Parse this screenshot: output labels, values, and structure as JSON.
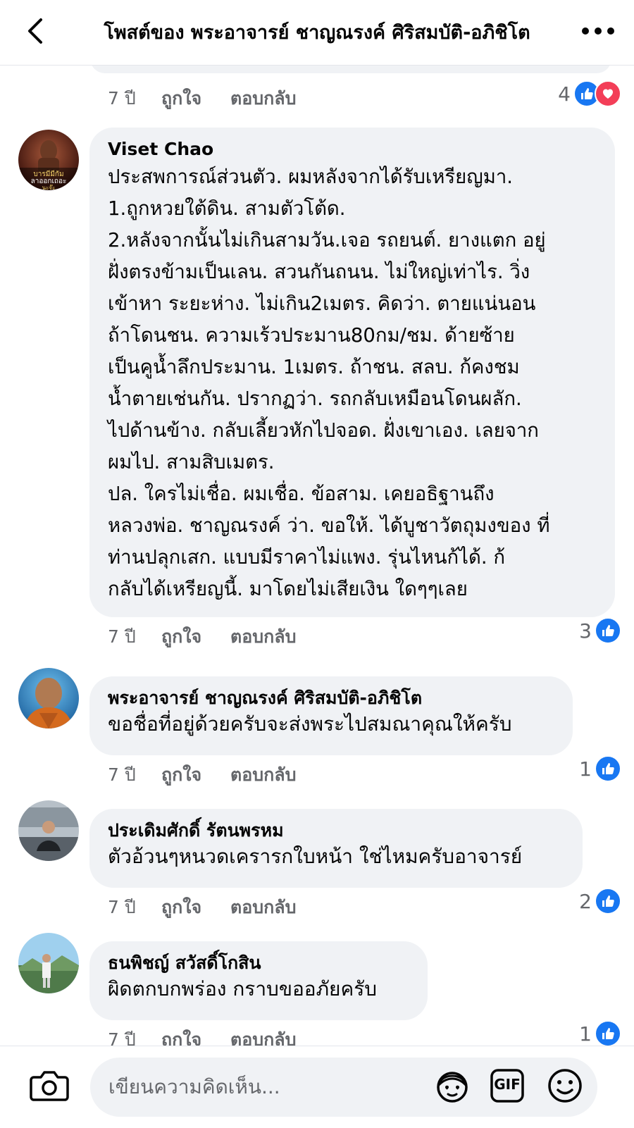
{
  "header": {
    "title": "โพสต์ของ พระอาจารย์ ชาญณรงค์ ศิริสมบัติ-อภิชิโต",
    "back_icon": "chevron-left-icon",
    "more_icon": "more-dots-icon"
  },
  "actions": {
    "like_label": "ถูกใจ",
    "reply_label": "ตอบกลับ"
  },
  "colors": {
    "accent": "#1877f2",
    "love": "#f33e58",
    "bubble": "#f0f2f5",
    "meta": "#65676b"
  },
  "comments": [
    {
      "author": "",
      "text": "",
      "time": "7 ปี",
      "reaction_count": "4",
      "reactions": [
        "like-icon",
        "love-icon"
      ]
    },
    {
      "author": "Viset Chao",
      "avatar_text": "บารมีมีกัมมีโส ลาออกเถอะ นะจ๊ะ",
      "text": "ประสพการณ์ส่วนตัว. ผมหลังจากได้รับเหรียญมา.\n1.ถูกหวยใต้ดิน.  สามตัวโต้ด.\n2.หลังจากนั้นไม่เกินสามวัน.เจอ รถยนต์. ยางแตก อยู่\nฝั่งตรงข้ามเป็นเลน. สวนกันถนน. ไม่ใหญ่เท่าไร. วิ่ง\nเข้าหา ระยะห่าง. ไม่เกิน2เมตร. คิดว่า. ตายแน่นอน\nถ้าโดนชน. ความเร้วประมาน80กม/ชม.  ด้ายซ้าย\nเป็นคูน้ำลึกประมาน. 1เมตร. ถ้าชน. สลบ. ก้คงชม\nน้ำตายเช่นกัน.   ปรากฏว่า. รถกลับเหมือนโดนผลัก.\nไปด้านข้าง. กลับเลี้ยวหักไปจอด. ฝั่งเขาเอง.  เลยจาก\nผมไป. สามสิบเมตร.\nปล.  ใครไม่เชื่อ. ผมเชื่อ.   ข้อสาม. เคยอธิฐานถึง\nหลวงพ่อ. ชาญณรงค์ ว่า. ขอให้. ได้บูชาวัตถุมงของ ที่\nท่านปลุกเสก.  แบบมีราคาไม่แพง. รุ่นไหนก้ได้. ก้\nกลับได้เหรียญนี้. มาโดยไม่เสียเงิน ใดๆๆเลย",
      "time": "7 ปี",
      "reaction_count": "3",
      "reactions": [
        "like-icon"
      ]
    },
    {
      "author": "พระอาจารย์ ชาญณรงค์ ศิริสมบัติ-อภิชิโต",
      "text": "ขอชื่อที่อยู่ด้วยครับจะส่งพระไปสมณาคุณให้ครับ",
      "time": "7 ปี",
      "reaction_count": "1",
      "reactions": [
        "like-icon"
      ]
    },
    {
      "author": "ประเดิมศักดิ์ รัตนพรหม",
      "text": "ตัวอ้วนๆหนวดเคราร​กใบหน้า ใช่ไหมครับอาจารย์",
      "time": "7 ปี",
      "reaction_count": "2",
      "reactions": [
        "like-icon"
      ]
    },
    {
      "author": "ธนพิชญ์ สวัสดิ์โกสิน",
      "text": "ผิดตกบกพร่อง กราบขออภัยครับ",
      "time": "7 ปี",
      "reaction_count": "1",
      "reactions": [
        "like-icon"
      ]
    }
  ],
  "composer": {
    "placeholder": "เขียนความคิดเห็น...",
    "camera_icon": "camera-icon",
    "avatar_sticker_icon": "avatar-sticker-icon",
    "gif_label": "GIF",
    "emoji_icon": "emoji-icon"
  }
}
